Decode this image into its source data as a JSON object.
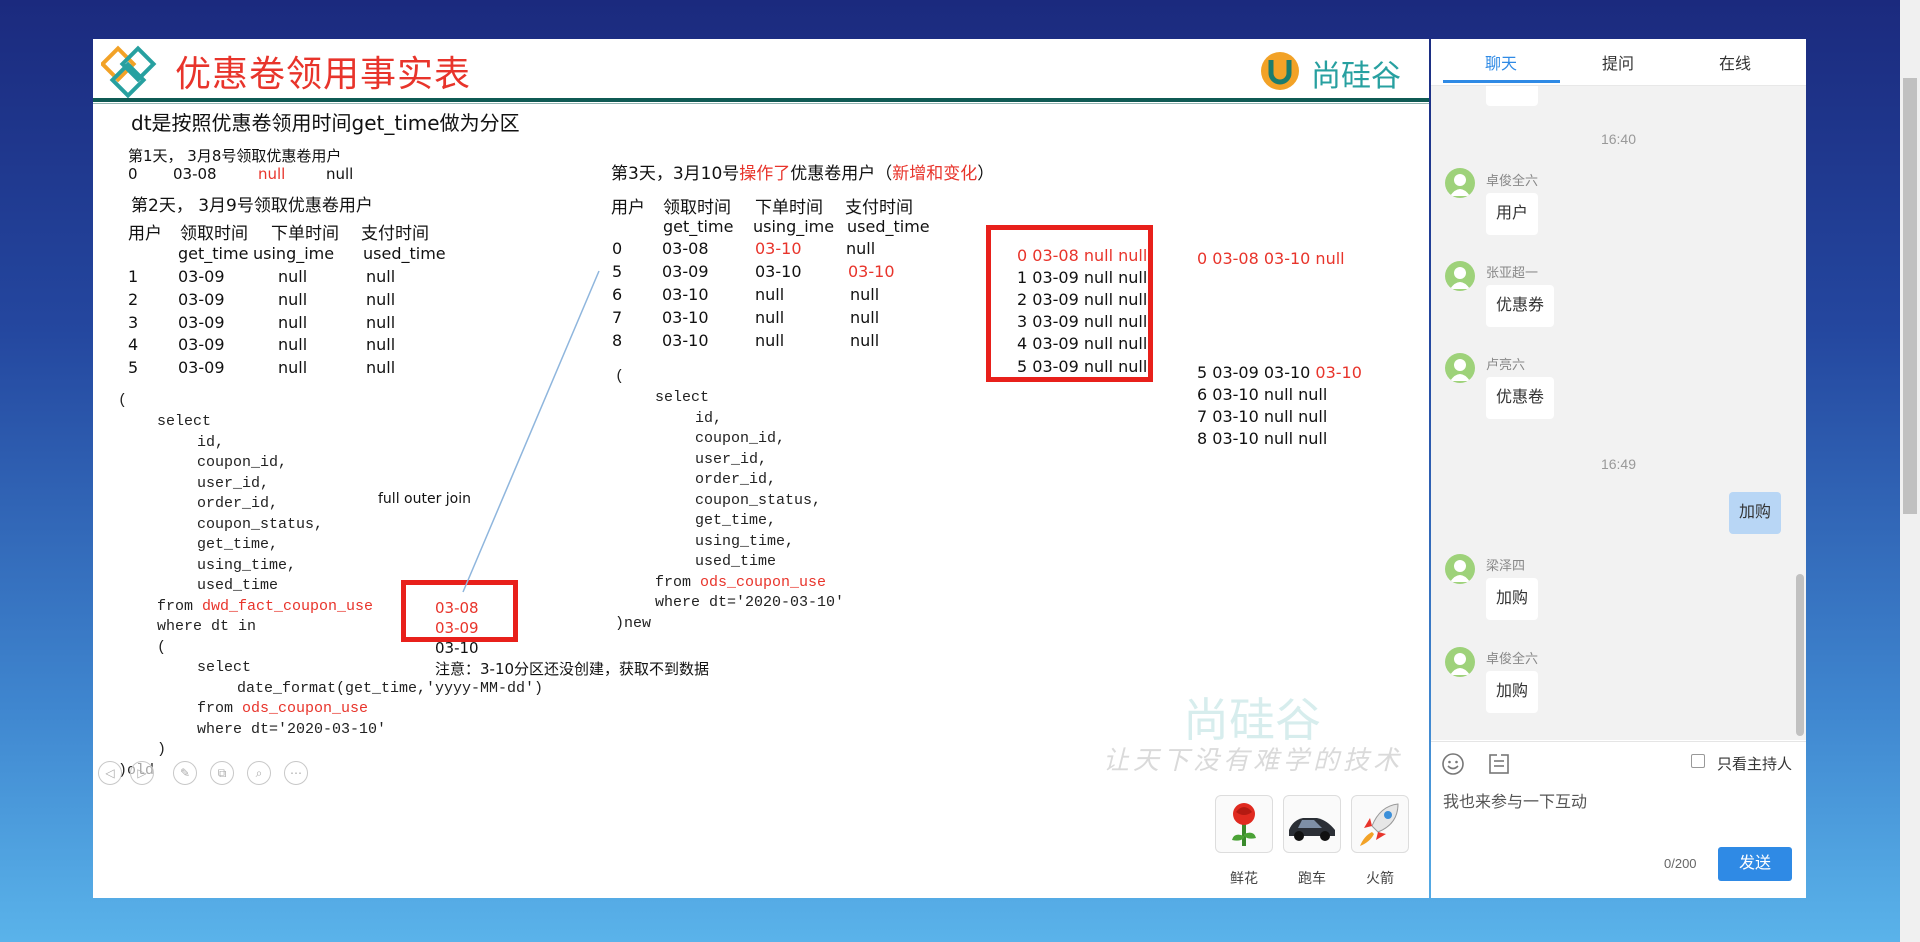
{
  "slide": {
    "title": "优惠卷领用事实表",
    "brand": "尚硅谷",
    "heading": "dt是按照优惠卷领用时间get_time做为分区",
    "day1": {
      "title": "第1天， 3月8号领取优惠卷用户",
      "row": [
        "0",
        "03-08",
        "null",
        "null"
      ]
    },
    "day2": {
      "title": "第2天， 3月9号领取优惠卷用户",
      "headers": [
        "用户",
        "领取时间",
        "下单时间",
        "支付时间"
      ],
      "subheaders": [
        "get_time",
        "using_ime",
        "used_time"
      ],
      "rows": [
        [
          "1",
          "03-09",
          "null",
          "null"
        ],
        [
          "2",
          "03-09",
          "null",
          "null"
        ],
        [
          "3",
          "03-09",
          "null",
          "null"
        ],
        [
          "4",
          "03-09",
          "null",
          "null"
        ],
        [
          "5",
          "03-09",
          "null",
          "null"
        ]
      ]
    },
    "day3": {
      "title_a": "第3天，3月10号",
      "title_b": "操作了",
      "title_c": "优惠卷用户（",
      "title_d": "新增和变化",
      "title_e": "）",
      "headers": [
        "用户",
        "领取时间",
        "下单时间",
        "支付时间"
      ],
      "subheaders": [
        "get_time",
        "using_ime",
        "used_time"
      ],
      "rows": [
        [
          "0",
          "03-08",
          "03-10",
          "null"
        ],
        [
          "5",
          "03-09",
          "03-10",
          "03-10"
        ],
        [
          "6",
          "03-10",
          "null",
          "null"
        ],
        [
          "7",
          "03-10",
          "null",
          "null"
        ],
        [
          "8",
          "03-10",
          "null",
          "null"
        ]
      ]
    },
    "old_box": [
      "0 03-08 null null",
      "1 03-09 null null",
      "2 03-09 null null",
      "3 03-09 null null",
      "4 03-09 null null",
      "5 03-09 null null"
    ],
    "result": {
      "r0": "0 03-08 03-10 null",
      "r5_a": "5 03-09 03-10 ",
      "r5_b": "03-10",
      "r6": "6 03-10 null null",
      "r7": "7 03-10 null null",
      "r8": "8 03-10 null null"
    },
    "join_label": "full outer join",
    "sql_old": {
      "open": "(",
      "select": "select",
      "fields": [
        "id,",
        "coupon_id,",
        "user_id,",
        "order_id,",
        "coupon_status,",
        "get_time,",
        "using_time,",
        "used_time"
      ],
      "from_kw": "from ",
      "from_tbl": "dwd_fact_coupon_use",
      "where": "where dt in",
      "paren": "(",
      "select2": "select",
      "date_fmt": "date_format(get_time,'yyyy-MM-dd')",
      "from2_kw": "from ",
      "from2_tbl": "ods_coupon_use",
      "where2": "where dt='2020-03-10'",
      "close": ")",
      "alias": ")old"
    },
    "dates_box": [
      "03-08",
      "03-09"
    ],
    "date_plain": "03-10",
    "note": "注意：3-10分区还没创建，获取不到数据",
    "sql_new": {
      "open": "(",
      "select": "select",
      "fields": [
        "id,",
        "coupon_id,",
        "user_id,",
        "order_id,",
        "coupon_status,",
        "get_time,",
        "using_time,",
        "used_time"
      ],
      "from_kw": "from ",
      "from_tbl": "ods_coupon_use",
      "where": "where dt='2020-03-10'",
      "alias": ")new"
    },
    "watermark_slogan": "让天下没有难学的技术"
  },
  "gifts": [
    {
      "label": "鲜花",
      "icon": "rose-icon"
    },
    {
      "label": "跑车",
      "icon": "sports-car-icon"
    },
    {
      "label": "火箭",
      "icon": "rocket-icon"
    }
  ],
  "chat": {
    "tabs": [
      "聊天",
      "提问",
      "在线"
    ],
    "time1": "16:40",
    "time2": "16:49",
    "msgs": [
      {
        "user": "卓俊全六",
        "text": "用户"
      },
      {
        "user": "张亚超一",
        "text": "优惠券"
      },
      {
        "user": "卢亮六",
        "text": "优惠卷"
      },
      {
        "user": "",
        "text": "加购"
      },
      {
        "user": "梁泽四",
        "text": "加购"
      },
      {
        "user": "卓俊全六",
        "text": "加购"
      }
    ],
    "host_only": "只看主持人",
    "input_placeholder": "我也来参与一下互动",
    "counter": "0/200",
    "send": "发送"
  },
  "colors": {
    "accent": "#e8342b",
    "brand_teal": "#0f5a54",
    "send_blue": "#2f8ae5"
  }
}
